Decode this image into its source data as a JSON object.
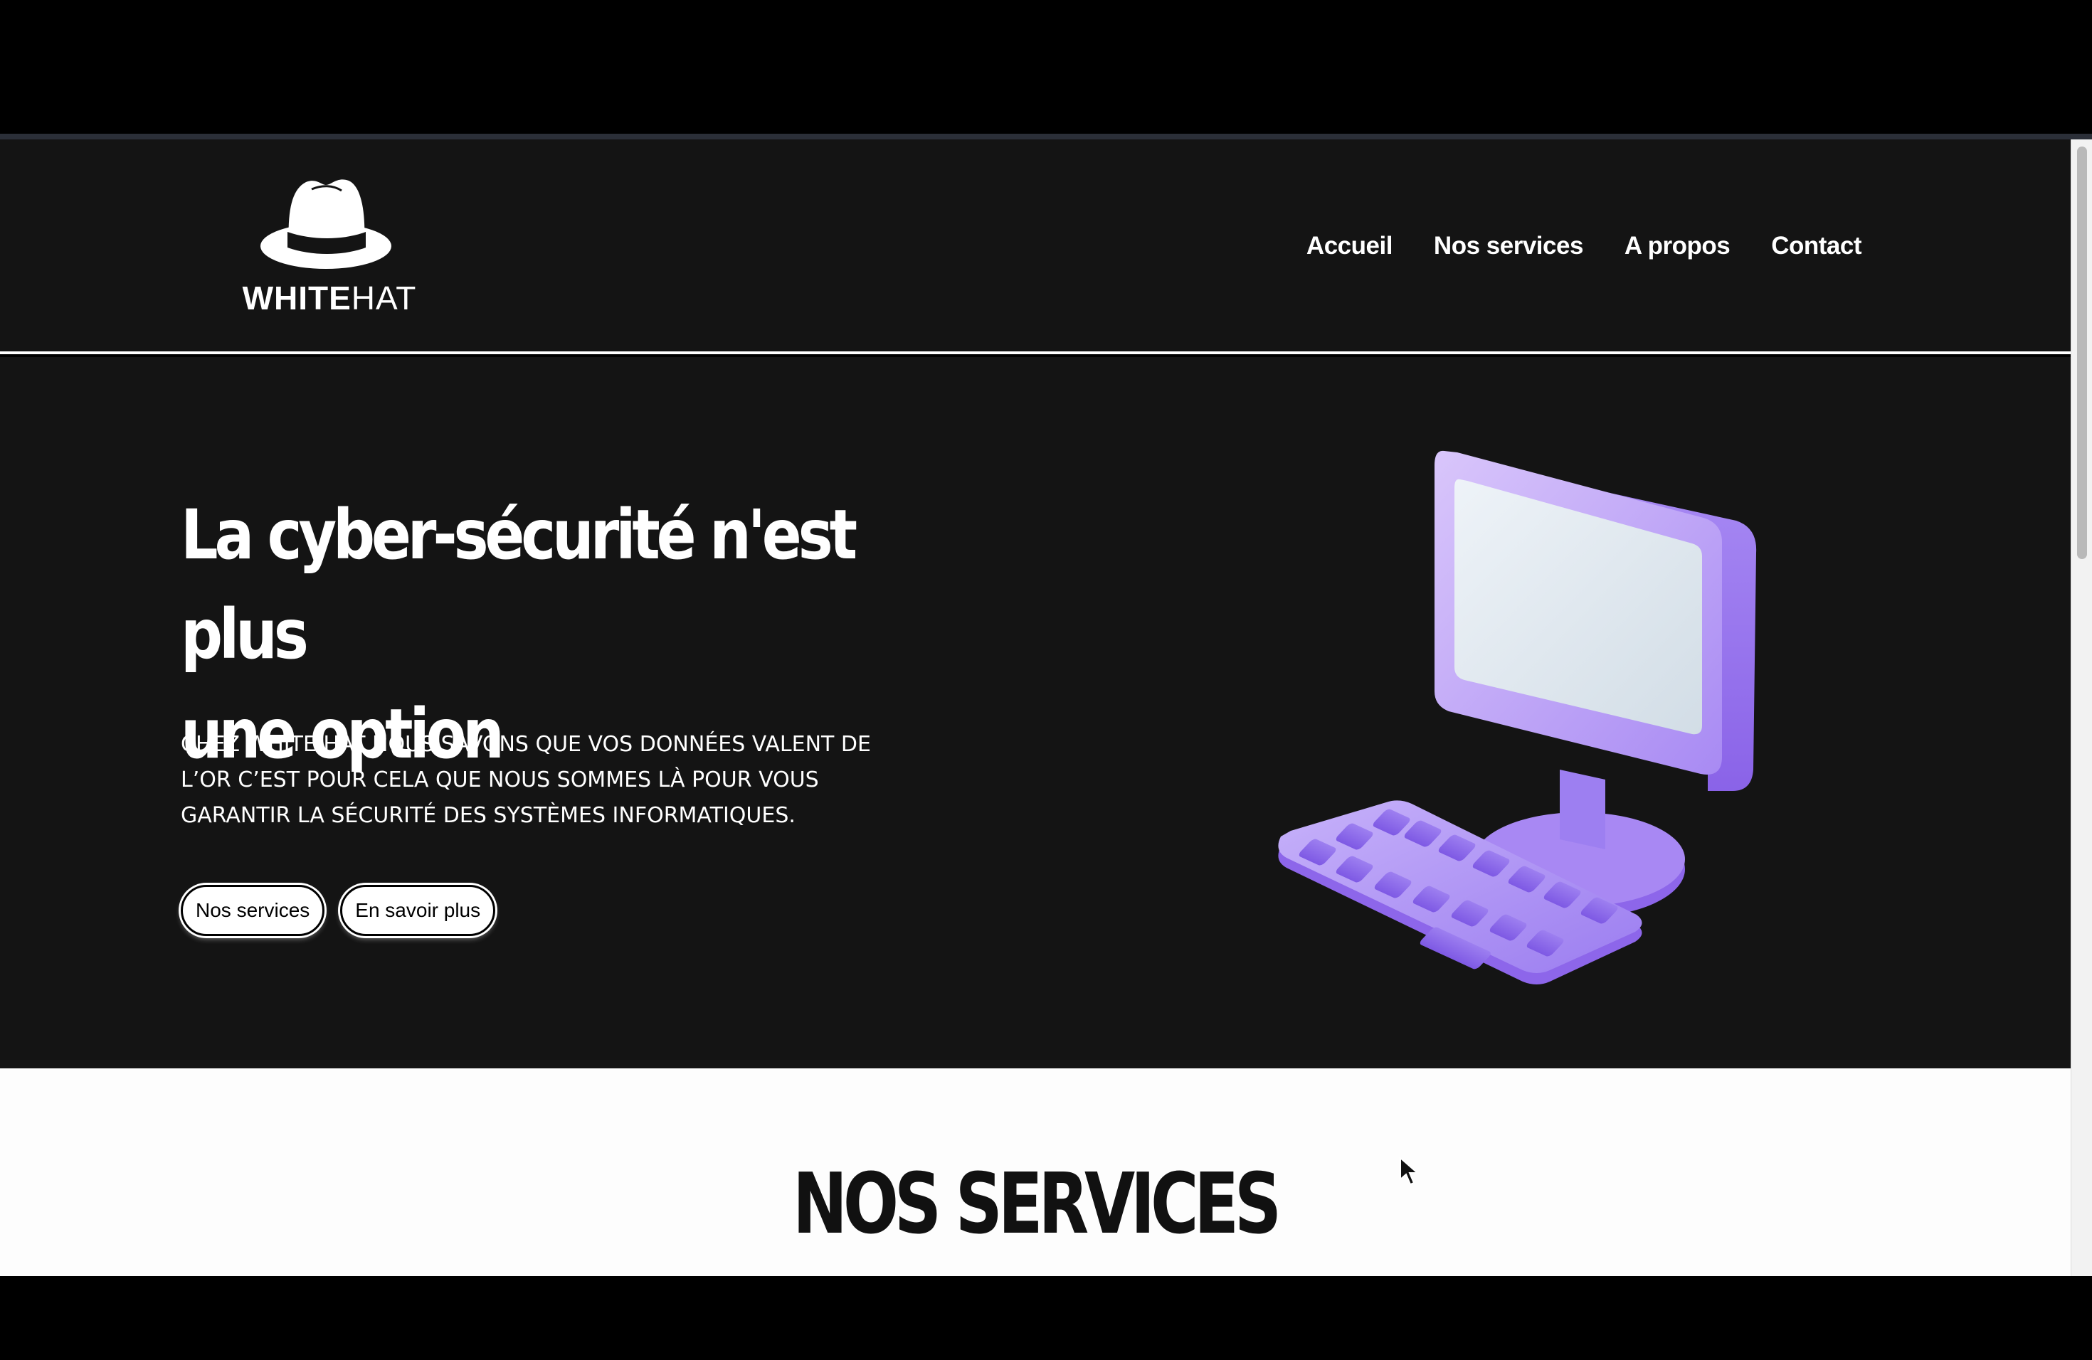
{
  "logo": {
    "text_bold": "WHITE",
    "text_thin": "HAT"
  },
  "nav": {
    "items": [
      {
        "label": "Accueil"
      },
      {
        "label": "Nos services"
      },
      {
        "label": "A propos"
      },
      {
        "label": "Contact"
      }
    ]
  },
  "hero": {
    "title_line1": "La cyber-sécurité n'est plus",
    "title_line2": "une option",
    "description": "CHEZ WHITE HAT NOUS SAVONS QUE VOS DONNÉES VALENT DE L’OR C’EST POUR CELA QUE NOUS SOMMES LÀ POUR VOUS GARANTIR LA SÉCURITÉ DES SYSTÈMES INFORMATIQUES.",
    "buttons": {
      "primary": "Nos services",
      "secondary": "En savoir plus"
    },
    "illustration_icon": "computer-keyboard-icon"
  },
  "services": {
    "title": "NOS SERVICES"
  },
  "colors": {
    "header_bg": "#141414",
    "hero_bg": "#141414",
    "accent_purple": "#9b7df0",
    "text_light": "#ffffff",
    "section_bg": "#fdfdfd"
  }
}
